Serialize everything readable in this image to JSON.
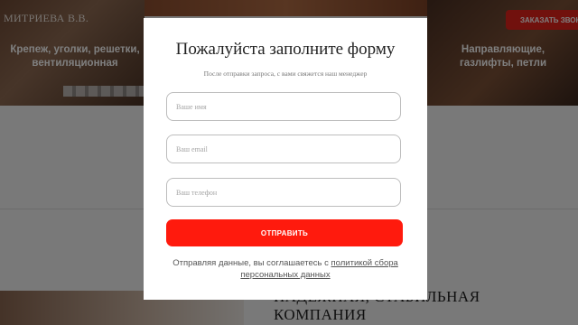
{
  "background": {
    "owner_name": "МИТРИЕВА В.В.",
    "category_left": "Крепеж, уголки, решетки, вентиляционная",
    "category_right": "Направляющие, газлифты, петли",
    "order_button": "ЗАКАЗАТЬ ЗВОН",
    "section_heading_line1": "НАДЕЖНАЯ, СТАБИЛЬНАЯ",
    "section_heading_line2": "КОМПАНИЯ"
  },
  "modal": {
    "title": "Пожалуйста заполните форму",
    "subtitle": "После отправки запроса, с вами свяжется наш менеджер",
    "name_placeholder": "Ваше имя",
    "email_placeholder": "Ваш email",
    "phone_placeholder": "Ваш телефон",
    "submit_label": "ОТПРАВИТЬ",
    "consent_text": "Отправляя данные, вы соглашаетесь с ",
    "consent_link": "политикой сбора персональных данных"
  },
  "colors": {
    "accent": "#ff1a0d",
    "overlay": "rgba(0,0,0,0.5)"
  }
}
